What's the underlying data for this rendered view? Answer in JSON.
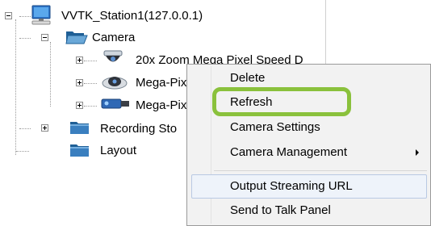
{
  "tree": {
    "station_label": "VVTK_Station1(127.0.0.1)",
    "camera_label": "Camera",
    "camera1_label": "20x Zoom Mega Pixel Speed D",
    "camera2_label": "Mega-Pix",
    "camera3_label": "Mega-Pix",
    "recording_label": "Recording Sto",
    "layout_label": "Layout"
  },
  "context_menu": {
    "items": [
      {
        "label": "Delete"
      },
      {
        "label": "Refresh"
      },
      {
        "label": "Camera Settings"
      },
      {
        "label": "Camera Management"
      },
      {
        "label": "Output Streaming URL"
      },
      {
        "label": "Send to Talk Panel"
      }
    ],
    "highlighted_item": "Output Streaming URL",
    "callout_item": "Refresh"
  },
  "colors": {
    "callout": "#8ac13c",
    "folder": "#2a7fb8",
    "menu_background": "#f2f2f2"
  }
}
